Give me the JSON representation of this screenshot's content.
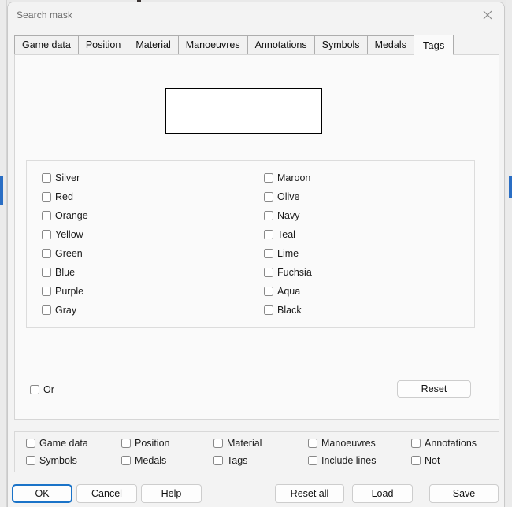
{
  "window": {
    "title": "Search mask",
    "close_icon": "close-icon"
  },
  "tabs": [
    {
      "label": "Game data",
      "active": false
    },
    {
      "label": "Position",
      "active": false
    },
    {
      "label": "Material",
      "active": false
    },
    {
      "label": "Manoeuvres",
      "active": false
    },
    {
      "label": "Annotations",
      "active": false
    },
    {
      "label": "Symbols",
      "active": false
    },
    {
      "label": "Medals",
      "active": false
    },
    {
      "label": "Tags",
      "active": true
    }
  ],
  "tags_panel": {
    "preview_value": "",
    "color_columns": {
      "left": [
        {
          "label": "Silver",
          "checked": false
        },
        {
          "label": "Red",
          "checked": false
        },
        {
          "label": "Orange",
          "checked": false
        },
        {
          "label": "Yellow",
          "checked": false
        },
        {
          "label": "Green",
          "checked": false
        },
        {
          "label": "Blue",
          "checked": false
        },
        {
          "label": "Purple",
          "checked": false
        },
        {
          "label": "Gray",
          "checked": false
        }
      ],
      "right": [
        {
          "label": "Maroon",
          "checked": false
        },
        {
          "label": "Olive",
          "checked": false
        },
        {
          "label": "Navy",
          "checked": false
        },
        {
          "label": "Teal",
          "checked": false
        },
        {
          "label": "Lime",
          "checked": false
        },
        {
          "label": "Fuchsia",
          "checked": false
        },
        {
          "label": "Aqua",
          "checked": false
        },
        {
          "label": "Black",
          "checked": false
        }
      ]
    },
    "or_label": "Or",
    "reset_label": "Reset"
  },
  "bottom_options": [
    {
      "label": "Game data",
      "checked": false
    },
    {
      "label": "Position",
      "checked": false
    },
    {
      "label": "Material",
      "checked": false
    },
    {
      "label": "Manoeuvres",
      "checked": false
    },
    {
      "label": "Annotations",
      "checked": false
    },
    {
      "label": "Symbols",
      "checked": false
    },
    {
      "label": "Medals",
      "checked": false
    },
    {
      "label": "Tags",
      "checked": false
    },
    {
      "label": "Include lines",
      "checked": false
    },
    {
      "label": "Not",
      "checked": false
    }
  ],
  "buttons": {
    "ok": "OK",
    "cancel": "Cancel",
    "help": "Help",
    "reset_all": "Reset all",
    "load": "Load",
    "save": "Save"
  },
  "colors": {
    "accent": "#1a73c8",
    "window_bg": "#f3f3f3",
    "panel_bg": "#fafafa",
    "title_text": "#6b6b6b"
  }
}
